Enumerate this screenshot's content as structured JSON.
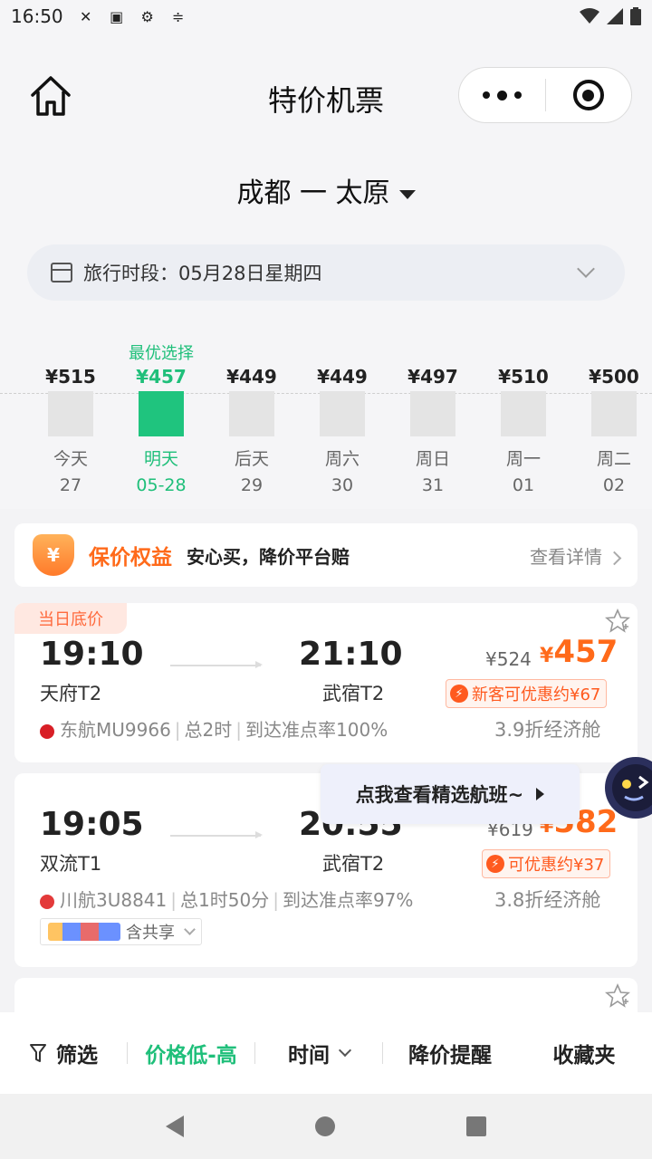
{
  "status_bar": {
    "time": "16:50"
  },
  "nav": {
    "title": "特价机票"
  },
  "route": {
    "text": "成都 一 太原"
  },
  "period": {
    "text": "旅行时段：05月28日星期四"
  },
  "dates": [
    {
      "best": "",
      "price": "¥515",
      "label": "今天",
      "num": "27",
      "active": false
    },
    {
      "best": "最优选择",
      "price": "¥457",
      "label": "明天",
      "num": "05-28",
      "active": true
    },
    {
      "best": "",
      "price": "¥449",
      "label": "后天",
      "num": "29",
      "active": false
    },
    {
      "best": "",
      "price": "¥449",
      "label": "周六",
      "num": "30",
      "active": false
    },
    {
      "best": "",
      "price": "¥497",
      "label": "周日",
      "num": "31",
      "active": false
    },
    {
      "best": "",
      "price": "¥510",
      "label": "周一",
      "num": "01",
      "active": false
    },
    {
      "best": "",
      "price": "¥500",
      "label": "周二",
      "num": "02",
      "active": false
    }
  ],
  "guarantee": {
    "badge": "¥",
    "title": "保价权益",
    "subtitle": "安心买，降价平台赔",
    "link": "查看详情"
  },
  "flights": [
    {
      "tag": "当日底价",
      "dep_time": "19:10",
      "dep_airport": "天府T2",
      "arr_time": "21:10",
      "arr_airport": "武宿T2",
      "old_price": "¥524",
      "price_yen": "¥",
      "price": "457",
      "promo": "新客可优惠约¥67",
      "airline": "东航MU9966",
      "duration": "总2时",
      "ontime": "到达准点率100%",
      "cabin": "3.9折经济舱",
      "logo_color": "#d81f26"
    },
    {
      "tag": "",
      "dep_time": "19:05",
      "dep_airport": "双流T1",
      "arr_time": "20:55",
      "arr_airport": "武宿T2",
      "old_price": "¥619",
      "price_yen": "¥",
      "price": "582",
      "promo": "可优惠约¥37",
      "airline": "川航3U8841",
      "duration": "总1时50分",
      "ontime": "到达准点率97%",
      "cabin": "3.8折经济舱",
      "logo_color": "#e33a3a",
      "share": "含共享"
    }
  ],
  "float_tip": {
    "text": "点我查看精选航班~"
  },
  "bottom_bar": {
    "filter": "筛选",
    "price_sort": "价格低-高",
    "time": "时间",
    "alert": "降价提醒",
    "favorites": "收藏夹"
  },
  "colors": {
    "accent_green": "#1fbf7a",
    "price_orange": "#ff6a1a"
  }
}
